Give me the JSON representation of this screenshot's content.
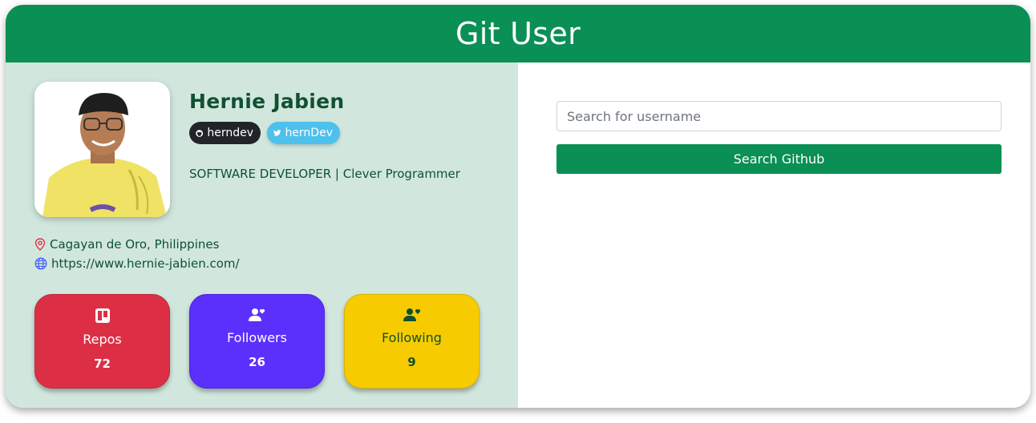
{
  "header": {
    "title": "Git User"
  },
  "profile": {
    "avatar_icon": "user-photo",
    "name": "Hernie Jabien",
    "github_badge": "herndev",
    "twitter_badge": "hernDev",
    "bio": "SOFTWARE DEVELOPER | Clever Programmer",
    "location": "Cagayan de Oro, Philippines",
    "website": "https://www.hernie-jabien.com/"
  },
  "stats": {
    "repos": {
      "label": "Repos",
      "count": "72",
      "icon": "repo-icon"
    },
    "followers": {
      "label": "Followers",
      "count": "26",
      "icon": "followers-icon"
    },
    "following": {
      "label": "Following",
      "count": "9",
      "icon": "following-icon"
    }
  },
  "search": {
    "placeholder": "Search for username",
    "value": "",
    "button_label": "Search Github"
  },
  "colors": {
    "brand_green": "#0a8f55",
    "panel_green": "#d1e7dd",
    "text_green": "#0f5132",
    "repos_red": "#dc2f45",
    "followers_purple": "#5b2ffc",
    "following_yellow": "#f6cc00",
    "github_dark": "#212529",
    "twitter_blue": "#4ec0ee"
  }
}
